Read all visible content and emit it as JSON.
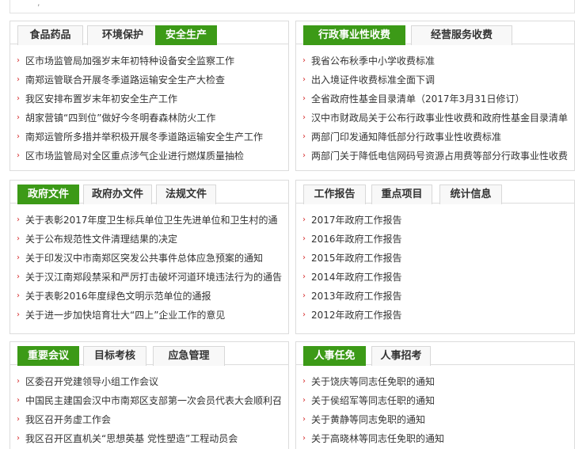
{
  "colors": {
    "accent": "#3c9a17",
    "bullet": "#d62b2b",
    "border": "#dcdcdc"
  },
  "icons": {
    "bullet": "chevron-right-icon"
  },
  "panels": [
    {
      "tabs": [
        "食品药品",
        "环境保护",
        "安全生产"
      ],
      "active": 2,
      "items": [
        "区市场监管局加强岁末年初特种设备安全监察工作",
        "南郑运管联合开展冬季道路运输安全生产大检查",
        "我区安排布置岁末年初安全生产工作",
        "胡家营镇“四到位”做好今冬明春森林防火工作",
        "南郑运管所多措并举积极开展冬季道路运输安全生产工作",
        "区市场监管局对全区重点涉气企业进行燃煤质量抽检"
      ]
    },
    {
      "tabs": [
        "行政事业性收费",
        "经营服务收费"
      ],
      "active": 0,
      "items": [
        "我省公布秋季中小学收费标准",
        "出入境证件收费标准全面下调",
        "全省政府性基金目录清单（2017年3月31日修订）",
        "汉中市财政局关于公布行政事业性收费和政府性基金目录清单",
        "两部门印发通知降低部分行政事业性收费标准",
        "两部门关于降低电信网码号资源占用费等部分行政事业性收费"
      ]
    },
    {
      "tabs": [
        "政府文件",
        "政府办文件",
        "法规文件"
      ],
      "active": 0,
      "items": [
        "关于表彰2017年度卫生标兵单位卫生先进单位和卫生村的通",
        "关于公布规范性文件清理结果的决定",
        "关于印发汉中市南郑区突发公共事件总体应急预案的通知",
        "关于汉江南郑段禁采和严厉打击破坏河道环境违法行为的通告",
        "关于表彰2016年度绿色文明示范单位的通报",
        "关于进一步加快培育壮大“四上”企业工作的意见"
      ]
    },
    {
      "tabs": [
        "工作报告",
        "重点项目",
        "统计信息"
      ],
      "active": -1,
      "items": [
        "2017年政府工作报告",
        "2016年政府工作报告",
        "2015年政府工作报告",
        "2014年政府工作报告",
        "2013年政府工作报告",
        "2012年政府工作报告"
      ]
    },
    {
      "tabs": [
        "重要会议",
        "目标考核",
        "应急管理"
      ],
      "active": 0,
      "items": [
        "区委召开党建领导小组工作会议",
        "中国民主建国会汉中市南郑区支部第一次会员代表大会顺利召",
        "我区召开务虚工作会",
        "我区召开区直机关“思想英基 党性塑造”工程动员会"
      ]
    },
    {
      "tabs": [
        "人事任免",
        "人事招考"
      ],
      "active": 0,
      "items": [
        "关于饶庆等同志任免职的通知",
        "关于侯绍军等同志任职的通知",
        "关于黄静等同志免职的通知",
        "关于高晓林等同志任免职的通知"
      ]
    }
  ]
}
